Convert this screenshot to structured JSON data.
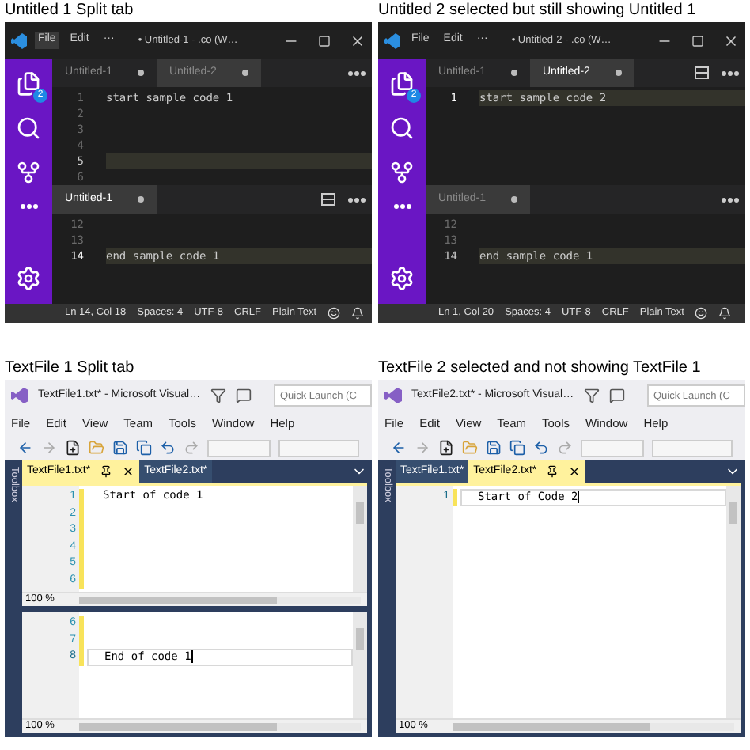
{
  "panels": [
    {
      "kind": "vscode",
      "caption": "Untitled 1 Split tab",
      "title": "• Untitled-1 - .co (W…",
      "menu": [
        {
          "label": "File",
          "selected": true
        },
        {
          "label": "Edit",
          "selected": false
        },
        {
          "label": "···",
          "selected": false
        }
      ],
      "badge": "2",
      "groups": [
        {
          "active": false,
          "split_button": false,
          "tabs": [
            {
              "label": "Untitled-1",
              "selected": false,
              "dirty": true
            },
            {
              "label": "Untitled-2",
              "selected": true,
              "dirty": true
            }
          ],
          "lines": [
            {
              "number": "1",
              "text": "start sample code 1",
              "current": false
            },
            {
              "number": "2",
              "current": false
            },
            {
              "number": "3",
              "current": false
            },
            {
              "number": "4",
              "current": false
            },
            {
              "number": "5",
              "current": true
            },
            {
              "number": "6",
              "current": false
            }
          ]
        },
        {
          "active": true,
          "split_button": true,
          "tabs": [
            {
              "label": "Untitled-1",
              "selected": true,
              "dirty": true
            }
          ],
          "lines": [
            {
              "number": "12",
              "current": false
            },
            {
              "number": "13",
              "current": false
            },
            {
              "number": "14",
              "text": "end sample code 1",
              "current": true
            }
          ]
        }
      ],
      "status": [
        "Ln 14, Col 18",
        "Spaces: 4",
        "UTF-8",
        "CRLF",
        "Plain Text"
      ]
    },
    {
      "kind": "vscode",
      "caption": "Untitled 2 selected but still showing Untitled 1",
      "title": "• Untitled-2 - .co (W…",
      "menu": [
        {
          "label": "File",
          "selected": false
        },
        {
          "label": "Edit",
          "selected": false
        },
        {
          "label": "···",
          "selected": false
        }
      ],
      "badge": "2",
      "groups": [
        {
          "active": true,
          "split_button": true,
          "tabs": [
            {
              "label": "Untitled-1",
              "selected": false,
              "dirty": true
            },
            {
              "label": "Untitled-2",
              "selected": true,
              "dirty": true
            }
          ],
          "lines": [
            {
              "number": "1",
              "text": "start sample code 2",
              "current": true
            }
          ]
        },
        {
          "active": false,
          "split_button": false,
          "tabs": [
            {
              "label": "Untitled-1",
              "selected": true,
              "dirty": true
            }
          ],
          "lines": [
            {
              "number": "12",
              "current": false
            },
            {
              "number": "13",
              "current": false
            },
            {
              "number": "14",
              "text": "end sample code 1",
              "current": true
            }
          ]
        }
      ],
      "status": [
        "Ln 1, Col 20",
        "Spaces: 4",
        "UTF-8",
        "CRLF",
        "Plain Text"
      ]
    },
    {
      "kind": "visualstudio",
      "caption": "TextFile 1 Split tab",
      "title": "TextFile1.txt* - Microsoft Visual…",
      "quick_launch": {
        "placeholder": "Quick Launch (C"
      },
      "menu": [
        "File",
        "Edit",
        "View",
        "Team",
        "Tools",
        "Window",
        "Help"
      ],
      "toolbox": "Toolbox",
      "tabs": [
        {
          "label": "TextFile1.txt*",
          "selected": true
        },
        {
          "label": "TextFile2.txt*",
          "selected": false
        }
      ],
      "panes": [
        {
          "zoom": "100 %",
          "lines": [
            {
              "number": "1",
              "text": "Start of code 1",
              "modified": true,
              "current": false
            },
            {
              "number": "2",
              "modified": true,
              "current": false
            },
            {
              "number": "3",
              "modified": true,
              "current": false
            },
            {
              "number": "4",
              "modified": true,
              "current": false
            },
            {
              "number": "5",
              "modified": true,
              "current": false
            },
            {
              "number": "6",
              "modified": true,
              "current": false
            }
          ]
        },
        {
          "zoom": "100 %",
          "lines": [
            {
              "number": "6",
              "modified": true,
              "current": false
            },
            {
              "number": "7",
              "modified": true,
              "current": false
            },
            {
              "number": "8",
              "text": "End of code 1",
              "modified": true,
              "current": true
            }
          ]
        }
      ]
    },
    {
      "kind": "visualstudio",
      "caption": "TextFile 2 selected and not showing TextFile 1",
      "title": "TextFile2.txt* - Microsoft Visual…",
      "quick_launch": {
        "placeholder": "Quick Launch (C"
      },
      "menu": [
        "File",
        "Edit",
        "View",
        "Team",
        "Tools",
        "Window",
        "Help"
      ],
      "toolbox": "Toolbox",
      "tabs": [
        {
          "label": "TextFile1.txt*",
          "selected": false
        },
        {
          "label": "TextFile2.txt*",
          "selected": true
        }
      ],
      "panes": [
        {
          "zoom": "100 %",
          "lines": [
            {
              "number": "1",
              "text": "Start of Code 2",
              "modified": true,
              "current": true
            }
          ]
        }
      ]
    }
  ]
}
